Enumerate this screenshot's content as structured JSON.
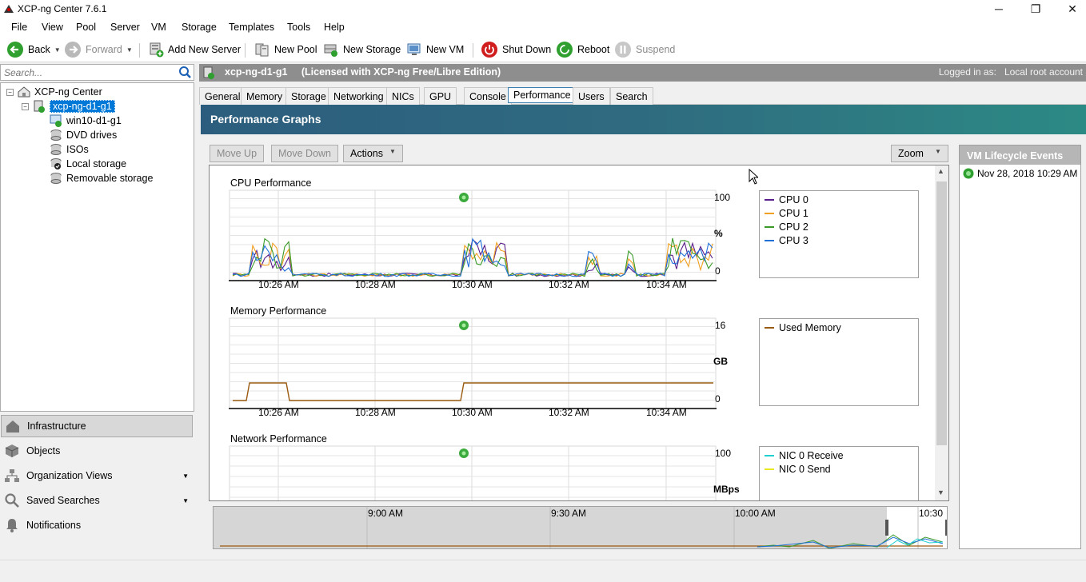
{
  "window": {
    "title": "XCP-ng Center 7.6.1",
    "minimize": "─",
    "maximize": "❐",
    "close": "✕"
  },
  "menu": [
    "File",
    "View",
    "Pool",
    "Server",
    "VM",
    "Storage",
    "Templates",
    "Tools",
    "Help"
  ],
  "toolbar": {
    "back": "Back",
    "forward": "Forward",
    "add_server": "Add New Server",
    "new_pool": "New Pool",
    "new_storage": "New Storage",
    "new_vm": "New VM",
    "shut_down": "Shut Down",
    "reboot": "Reboot",
    "suspend": "Suspend"
  },
  "search": {
    "placeholder": "Search..."
  },
  "tree": {
    "root": "XCP-ng Center",
    "host": "xcp-ng-d1-g1",
    "children": [
      "win10-d1-g1",
      "DVD drives",
      "ISOs",
      "Local storage",
      "Removable storage"
    ]
  },
  "nav": [
    "Infrastructure",
    "Objects",
    "Organization Views",
    "Saved Searches",
    "Notifications"
  ],
  "header": {
    "title": "xcp-ng-d1-g1",
    "license": "(Licensed with XCP-ng Free/Libre Edition)",
    "login_label": "Logged in as:",
    "login_value": "Local root account"
  },
  "tabs": [
    "General",
    "Memory",
    "Storage",
    "Networking",
    "NICs",
    "GPU",
    "Console",
    "Performance",
    "Users",
    "Search"
  ],
  "active_tab": "Performance",
  "banner": "Performance Graphs",
  "actions": {
    "move_up": "Move Up",
    "move_down": "Move Down",
    "actions": "Actions",
    "zoom": "Zoom"
  },
  "graphs": {
    "cpu": {
      "title": "CPU Performance",
      "ymax": "100",
      "ymin": "0",
      "unit": "%",
      "legend": [
        {
          "name": "CPU 0",
          "color": "#5a1e8c"
        },
        {
          "name": "CPU 1",
          "color": "#f0a020"
        },
        {
          "name": "CPU 2",
          "color": "#3a9a28"
        },
        {
          "name": "CPU 3",
          "color": "#2070d8"
        }
      ]
    },
    "memory": {
      "title": "Memory Performance",
      "ymax": "16",
      "ymin": "0",
      "unit": "GB",
      "legend": [
        {
          "name": "Used Memory",
          "color": "#9a5a10"
        }
      ]
    },
    "network": {
      "title": "Network Performance",
      "ymax": "100",
      "unit": "MBps",
      "legend": [
        {
          "name": "NIC 0 Receive",
          "color": "#20d0d0"
        },
        {
          "name": "NIC 0 Send",
          "color": "#e8e820"
        }
      ]
    },
    "xticks": [
      "10:26 AM",
      "10:28 AM",
      "10:30 AM",
      "10:32 AM",
      "10:34 AM"
    ]
  },
  "events": {
    "header": "VM Lifecycle Events",
    "items": [
      "Nov 28, 2018 10:29 AM"
    ]
  },
  "timeline": {
    "ticks": [
      "9:00 AM",
      "9:30 AM",
      "10:00 AM",
      "10:30"
    ]
  }
}
